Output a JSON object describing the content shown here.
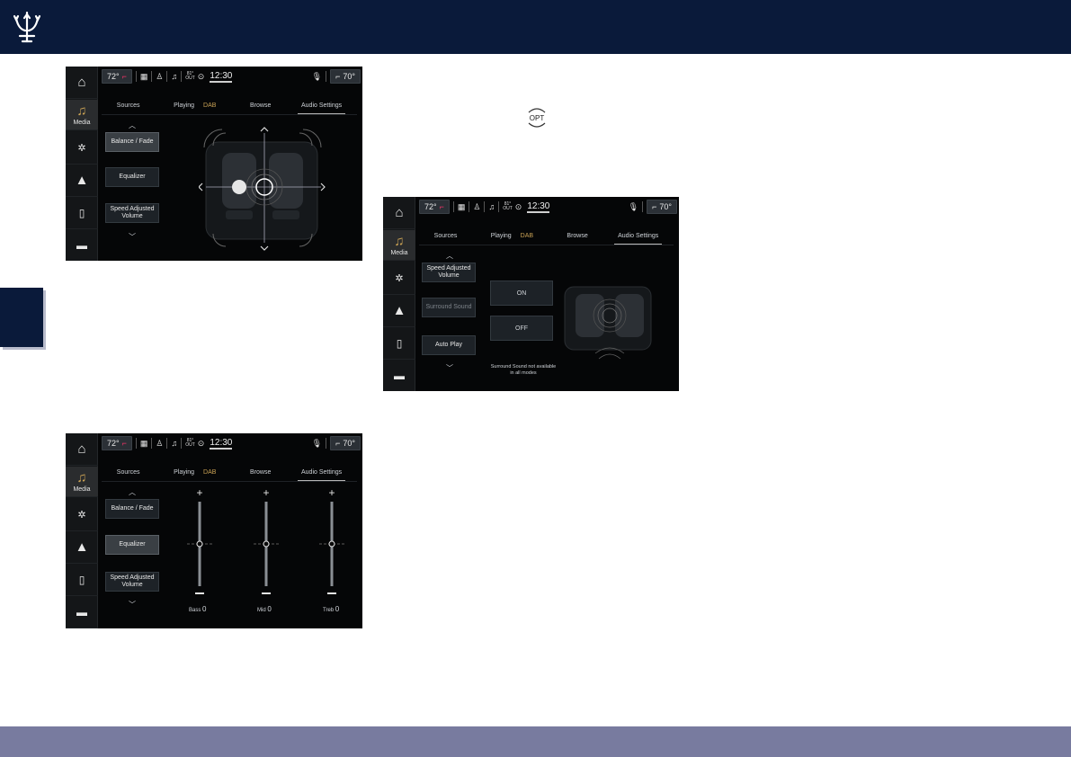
{
  "status": {
    "temp_left": "72°",
    "out_top": "81°",
    "out_bottom": "OUT",
    "time": "12:30",
    "temp_right": "70°"
  },
  "rail": {
    "media_label": "Media"
  },
  "tabs": {
    "sources": "Sources",
    "playing": "Playing",
    "dab": "DAB",
    "browse": "Browse",
    "audio_settings": "Audio Settings"
  },
  "screen1": {
    "balance_fade": "Balance / Fade",
    "equalizer": "Equalizer",
    "sav_line1": "Speed Adjusted",
    "sav_line2": "Volume"
  },
  "screen2": {
    "sav_line1": "Speed Adjusted",
    "sav_line2": "Volume",
    "surround": "Surround Sound",
    "auto_play": "Auto Play",
    "on": "ON",
    "off": "OFF",
    "note_line1": "Surround Sound not available",
    "note_line2": "in all modes"
  },
  "screen3": {
    "balance_fade": "Balance / Fade",
    "equalizer": "Equalizer",
    "sav_line1": "Speed Adjusted",
    "sav_line2": "Volume",
    "bands": [
      {
        "name": "Bass",
        "value": "0"
      },
      {
        "name": "Mid",
        "value": "0"
      },
      {
        "name": "Treb",
        "value": "0"
      }
    ]
  },
  "colors": {
    "header": "#0a1a3a",
    "footer": "#787b9f",
    "accent": "#c9a154"
  }
}
